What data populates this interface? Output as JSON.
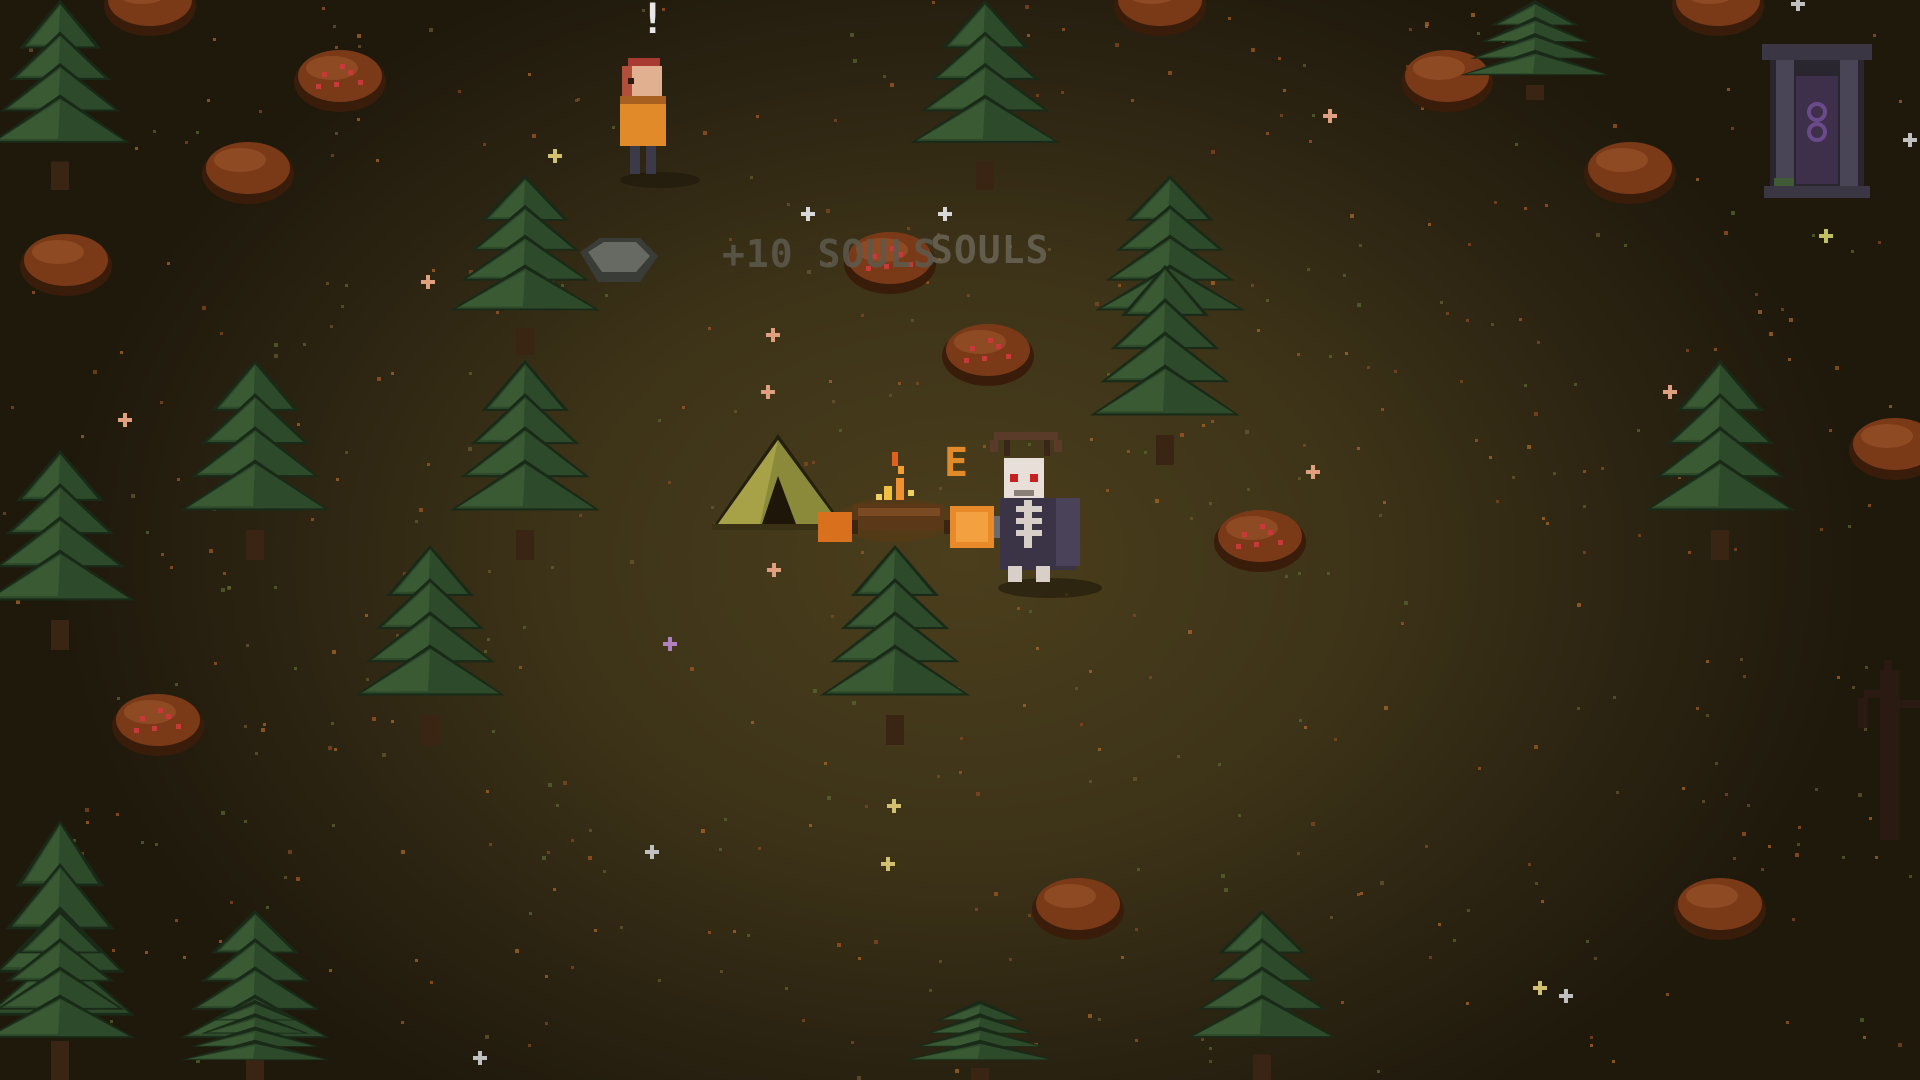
{
  "floating_text": {
    "soul_gain_1": "+10 SOULS",
    "soul_gain_2": "SOULS"
  },
  "interaction": {
    "key_prompt": "E"
  },
  "npc": {
    "alert_marker": "!"
  },
  "icons": {
    "campfire": "campfire-icon",
    "tent": "tent-icon",
    "shrine": "stone-shrine-icon",
    "player": "skeleton-player",
    "npc": "villager-npc"
  },
  "colors": {
    "ground": "#3d3318",
    "tree": "#2d4a2a",
    "bush": "#7a3a18",
    "berry": "#c83a3a",
    "fire": "#f09030",
    "prompt": "#e08a2a"
  }
}
